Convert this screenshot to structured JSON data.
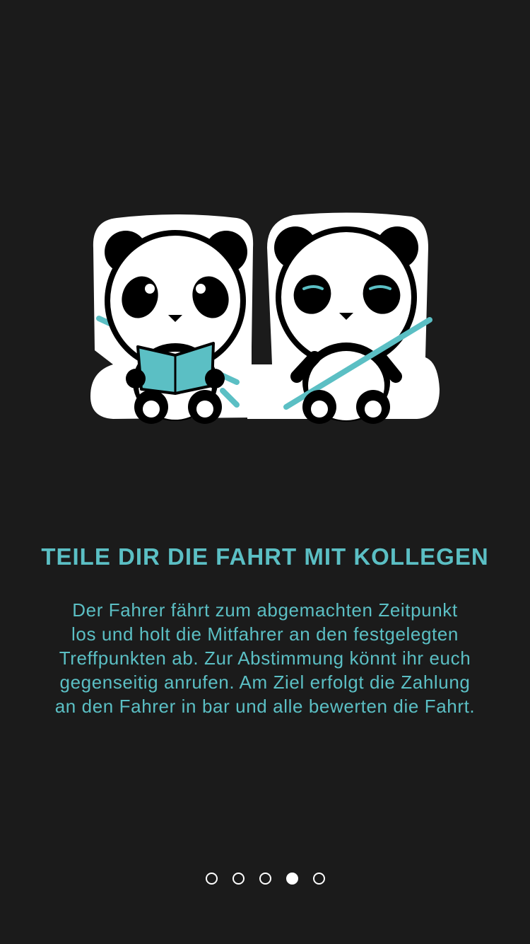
{
  "onboarding": {
    "title": "TEILE DIR DIE FAHRT MIT KOLLEGEN",
    "description_lines": [
      "Der Fahrer fährt zum abgemachten Zeitpunkt",
      "los und holt die Mitfahrer an den festgelegten",
      "Treffpunkten ab. Zur Abstimmung könnt ihr euch",
      "gegenseitig anrufen. Am Ziel erfolgt die Zahlung",
      "an den Fahrer in bar und alle bewerten die Fahrt."
    ],
    "illustration": {
      "icon": "two-pandas-car-seats-illustration",
      "accent_color": "#5bbfc4"
    },
    "pagination": {
      "total": 5,
      "active_page": 4
    }
  },
  "colors": {
    "background": "#1b1b1b",
    "accent": "#5bbfc4",
    "dot": "#ffffff"
  }
}
